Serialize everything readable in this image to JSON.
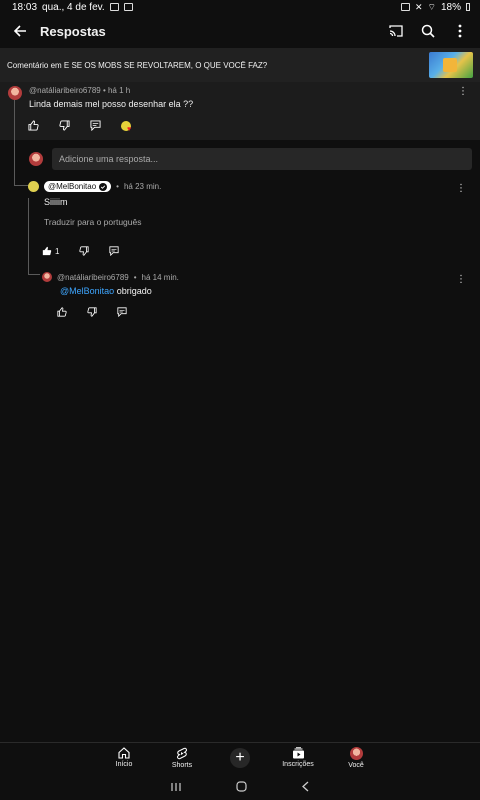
{
  "status": {
    "time": "18:03",
    "date": "qua., 4 de fev.",
    "battery": "18%"
  },
  "header": {
    "title": "Respostas"
  },
  "video": {
    "comment_on": "Comentário em E SE OS MOBS SE REVOLTAREM, O QUE VOCÊ FAZ?"
  },
  "parent_comment": {
    "author": "@natáliaribeiro6789",
    "time": "há 1 h",
    "text": "Linda demais mel posso desenhar ela ??"
  },
  "reply_input": {
    "placeholder": "Adicione uma resposta..."
  },
  "reply1": {
    "author": "@MelBonitao",
    "time": "há 23 min.",
    "text": "Siiiiim",
    "translate": "Traduzir para o português",
    "likes": "1"
  },
  "reply2": {
    "author": "@natáliaribeiro6789",
    "time": "há 14 min.",
    "mention": "@MelBonitao",
    "text": "obrigado"
  },
  "nav": {
    "home": "Início",
    "shorts": "Shorts",
    "subscriptions": "Inscrições",
    "you": "Você"
  },
  "colors": {
    "background": "#0f0f0f",
    "link": "#3ea6ff",
    "panel": "#1c1c1c"
  },
  "icons": [
    "back-arrow-icon",
    "cast-icon",
    "search-icon",
    "more-vert-icon",
    "like-icon",
    "dislike-icon",
    "reply-icon",
    "creator-heart-icon",
    "verified-icon",
    "home-icon",
    "shorts-icon",
    "create-icon",
    "subscriptions-icon"
  ]
}
